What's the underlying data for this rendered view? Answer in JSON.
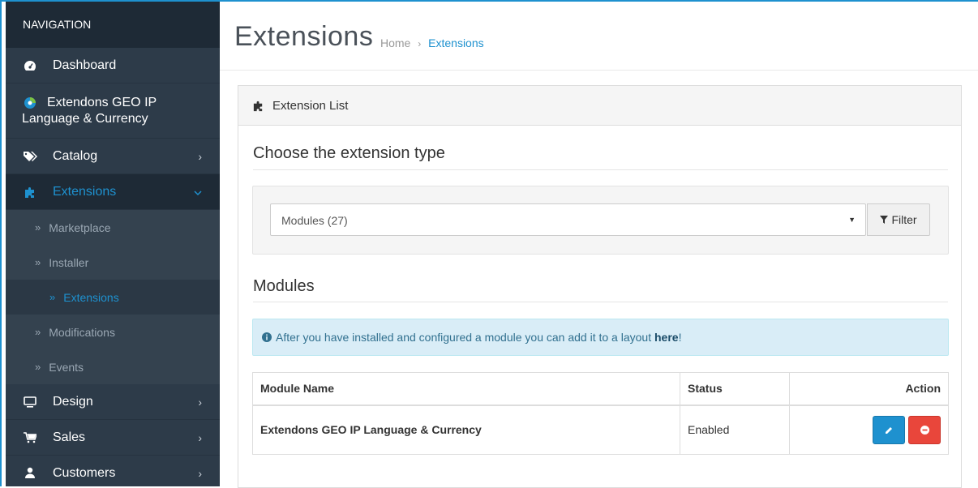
{
  "sidebar": {
    "heading": "NAVIGATION",
    "items": [
      {
        "label": "Dashboard",
        "icon": "dashboard-icon"
      },
      {
        "label_line1": "Extendons GEO IP",
        "label_line2": "Language & Currency",
        "icon": "extendons-logo-icon"
      },
      {
        "label": "Catalog",
        "icon": "tag-icon"
      },
      {
        "label": "Extensions",
        "icon": "puzzle-icon",
        "active": true
      },
      {
        "label": "Design",
        "icon": "desktop-icon"
      },
      {
        "label": "Sales",
        "icon": "cart-icon"
      },
      {
        "label": "Customers",
        "icon": "user-icon"
      }
    ],
    "subitems": [
      {
        "label": "Marketplace"
      },
      {
        "label": "Installer"
      },
      {
        "label": "Extensions",
        "current": true
      },
      {
        "label": "Modifications"
      },
      {
        "label": "Events"
      }
    ],
    "chevron": "›",
    "chevron_down": "⌄",
    "sub_prefix": "»"
  },
  "header": {
    "title": "Extensions",
    "breadcrumb": [
      "Home",
      "Extensions"
    ],
    "breadcrumb_sep": "›"
  },
  "panel": {
    "title": "Extension List",
    "choose_title": "Choose the extension type",
    "select_value": "Modules (27)",
    "filter_label": "Filter",
    "modules_title": "Modules",
    "alert_text": "After you have installed and configured a module you can add it to a layout ",
    "alert_link": "here",
    "alert_end": "!",
    "table": {
      "headers": [
        "Module Name",
        "Status",
        "Action"
      ],
      "rows": [
        {
          "name": "Extendons GEO IP Language & Currency",
          "status": "Enabled"
        }
      ]
    }
  },
  "colors": {
    "accent": "#1e91cf",
    "danger": "#e9463b",
    "sidebar": "#2d3b49"
  }
}
